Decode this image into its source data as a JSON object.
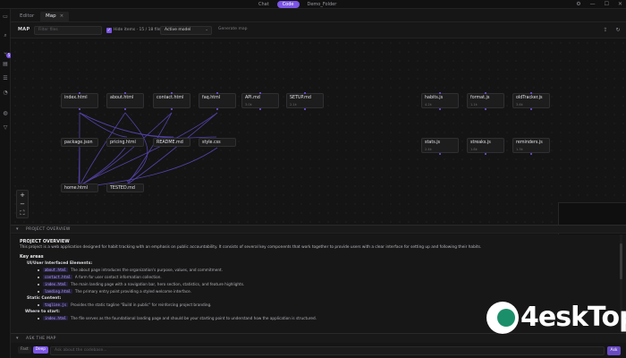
{
  "topbar": {
    "modes": [
      "Chat",
      "Code",
      "Demo_Folder"
    ],
    "active_mode": "Code",
    "window_controls": [
      "settings-icon",
      "minimize-icon",
      "maximize-icon",
      "close-icon"
    ]
  },
  "rail": {
    "icons": [
      "files-icon",
      "search-icon",
      "branch-icon",
      "layers-icon",
      "list-icon",
      "comment-icon",
      "globe-icon",
      "filter-icon"
    ],
    "badge": "5"
  },
  "tabs": [
    {
      "label": "Editor"
    },
    {
      "label": "Map",
      "close": "×"
    }
  ],
  "toolbar": {
    "title": "MAP",
    "filter_placeholder": "Filter files",
    "check_label": "Hide items · 15 / 18 files",
    "select_value": "Active model",
    "generate_label": "Generate map"
  },
  "nodes": [
    {
      "label": "index.html",
      "sub": ""
    },
    {
      "label": "about.html",
      "sub": ""
    },
    {
      "label": "contact.html",
      "sub": ""
    },
    {
      "label": "faq.html",
      "sub": ""
    },
    {
      "label": "API.md",
      "sub": "3.0k"
    },
    {
      "label": "SETUP.md",
      "sub": "2.1k"
    },
    {
      "label": "habits.js",
      "sub": "4.2k"
    },
    {
      "label": "format.js",
      "sub": "1.1k"
    },
    {
      "label": "oldTracker.js",
      "sub": "3.6k"
    },
    {
      "label": "package.json",
      "sub": ""
    },
    {
      "label": "pricing.html",
      "sub": ""
    },
    {
      "label": "README.md",
      "sub": ""
    },
    {
      "label": "style.css",
      "sub": ""
    },
    {
      "label": "stats.js",
      "sub": "2.4k"
    },
    {
      "label": "streaks.js",
      "sub": "1.8k"
    },
    {
      "label": "reminders.js",
      "sub": "1.3k"
    },
    {
      "label": "home.html",
      "sub": ""
    },
    {
      "label": "TESTED.md",
      "sub": ""
    }
  ],
  "zoom": {
    "plus": "+",
    "minus": "−",
    "fit": "⛶"
  },
  "overview": {
    "header": "PROJECT OVERVIEW",
    "title": "PROJECT OVERVIEW",
    "intro": "This project is a web application designed for habit tracking with an emphasis on public accountability. It consists of several key components that work together to provide users with a clear interface for setting up and following their habits.",
    "key_areas": "Key areas",
    "ui_title": "UI/User Interfaced Elements:",
    "ui_items": [
      {
        "code": "about.html",
        "text": "The about page introduces the organization's purpose, values, and commitment."
      },
      {
        "code": "contact.html",
        "text": "A form for user contact information collection."
      },
      {
        "code": "index.html",
        "text": "The main landing page with a navigation bar, hero section, statistics, and feature highlights."
      },
      {
        "code": "landing.html",
        "text": "The primary entry point providing a styled welcome interface."
      }
    ],
    "static_title": "Static Content:",
    "static_items": [
      {
        "code": "tagline.js",
        "text": "Provides the static tagline \"Build in public\" for reinforcing project branding."
      }
    ],
    "where_title": "Where to start:",
    "where_items": [
      {
        "code": "index.html",
        "text": "The file serves as the foundational landing page and should be your starting point to understand how the application is structured."
      }
    ]
  },
  "ask": {
    "header": "ASK THE MAP",
    "segments": [
      "Fast",
      "Deep"
    ],
    "active_segment": "Deep",
    "placeholder": "Ask about the codebase...",
    "button": "Ask"
  },
  "watermark": {
    "text": "4eskTop"
  },
  "colors": {
    "accent": "#7c55e6",
    "background": "#151515",
    "node": "#1d1d1d"
  }
}
